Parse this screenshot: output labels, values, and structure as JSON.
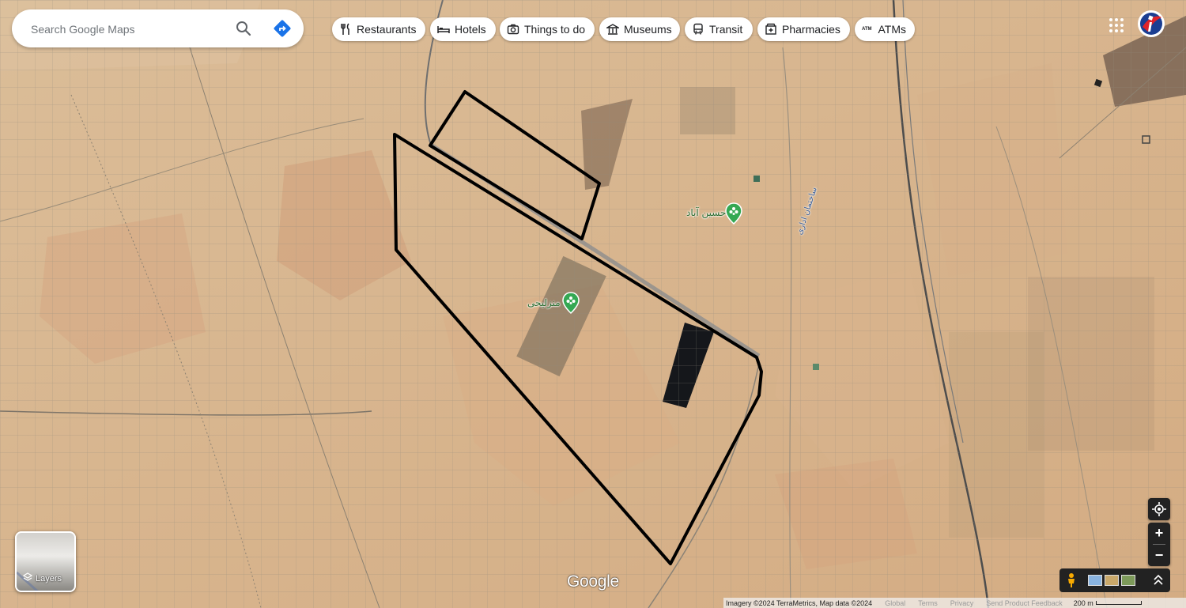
{
  "search": {
    "placeholder": "Search Google Maps"
  },
  "icons": {
    "search": "search-icon",
    "directions": "directions-icon",
    "apps": "apps-grid-icon",
    "layers": "layers-icon",
    "location": "my-location-icon",
    "pegman": "pegman-icon",
    "expand": "chevron-up-icon"
  },
  "chips": [
    {
      "label": "Restaurants",
      "icon": "fork-knife-icon"
    },
    {
      "label": "Hotels",
      "icon": "bed-icon"
    },
    {
      "label": "Things to do",
      "icon": "camera-icon"
    },
    {
      "label": "Museums",
      "icon": "museum-icon"
    },
    {
      "label": "Transit",
      "icon": "bus-icon"
    },
    {
      "label": "Pharmacies",
      "icon": "pharmacy-icon"
    },
    {
      "label": "ATMs",
      "icon": "atm-icon"
    }
  ],
  "places": [
    {
      "name": "حسین آباد",
      "color": "#34a853"
    },
    {
      "name": "منزلیحی",
      "color": "#34a853"
    }
  ],
  "road_label": "ساختمان اداری",
  "layers_label": "Layers",
  "zoom": {
    "in": "+",
    "out": "−"
  },
  "logo": "Google",
  "footer": {
    "attribution": "Imagery ©2024 TerraMetrics, Map data ©2024",
    "global": "Global",
    "terms": "Terms",
    "privacy": "Privacy",
    "feedback": "Send Product Feedback",
    "scale": "200 m"
  },
  "colors": {
    "accent": "#1a73e8",
    "place_pin": "#34a853",
    "boundary": "#000000"
  }
}
